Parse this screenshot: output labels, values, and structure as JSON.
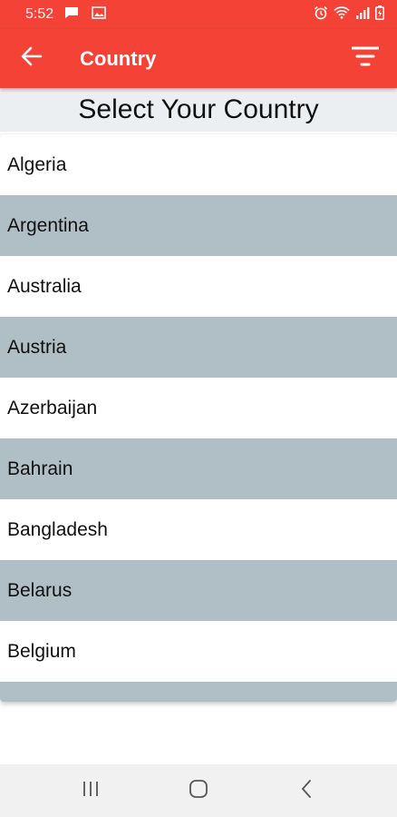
{
  "status_bar": {
    "time": "5:52",
    "left_icons": [
      "message-icon",
      "image-icon"
    ],
    "right_icons": [
      "alarm-icon",
      "wifi-icon",
      "signal-icon",
      "battery-icon"
    ]
  },
  "app_bar": {
    "title": "Country",
    "back_icon": "arrow-left-icon",
    "filter_icon": "filter-icon"
  },
  "heading": "Select Your Country",
  "countries": [
    "Algeria",
    "Argentina",
    "Australia",
    "Austria",
    "Azerbaijan",
    "Bahrain",
    "Bangladesh",
    "Belarus",
    "Belgium"
  ],
  "colors": {
    "accent": "#f44336",
    "row_alt": "#b0bec5",
    "heading_band": "#eceff1",
    "nav_bar": "#f1f1f1"
  },
  "nav_bar": {
    "buttons": [
      "recent-apps-icon",
      "home-icon",
      "back-icon"
    ]
  }
}
